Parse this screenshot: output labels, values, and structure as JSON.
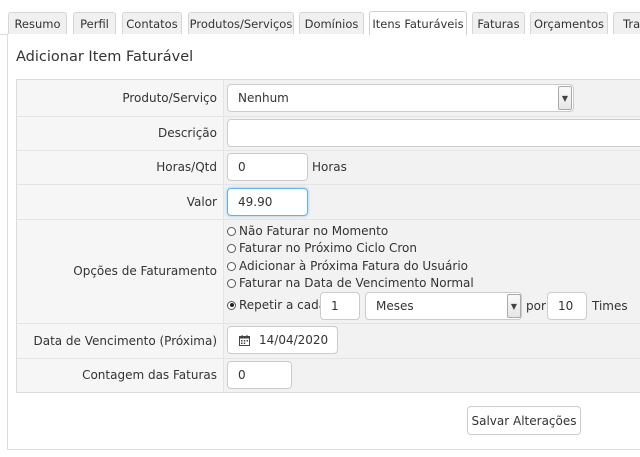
{
  "tabs": [
    {
      "label": "Resumo",
      "active": false
    },
    {
      "label": "Perfil",
      "active": false
    },
    {
      "label": "Contatos",
      "active": false
    },
    {
      "label": "Produtos/Serviços",
      "active": false
    },
    {
      "label": "Domínios",
      "active": false
    },
    {
      "label": "Itens Faturáveis",
      "active": true
    },
    {
      "label": "Faturas",
      "active": false
    },
    {
      "label": "Orçamentos",
      "active": false
    },
    {
      "label": "Tra",
      "active": false
    }
  ],
  "page": {
    "title": "Adicionar Item Faturável"
  },
  "form": {
    "produto": {
      "label": "Produto/Serviço",
      "value": "Nenhum",
      "icon": "chevron-down-icon"
    },
    "descricao": {
      "label": "Descrição",
      "value": ""
    },
    "horas": {
      "label": "Horas/Qtd",
      "value": "0",
      "unit": "Horas"
    },
    "valor": {
      "label": "Valor",
      "value": "49.90"
    },
    "opcoes": {
      "label": "Opções de Faturamento",
      "options": [
        "Não Faturar no Momento",
        "Faturar no Próximo Ciclo Cron",
        "Adicionar à Próxima Fatura do Usuário",
        "Faturar na Data de Vencimento Normal"
      ],
      "repeat": {
        "label": "Repetir a cada",
        "count": "1",
        "period": "Meses",
        "por_label": "por",
        "times_value": "10",
        "times_label": "Times",
        "checked": true
      }
    },
    "vencimento": {
      "label": "Data de Vencimento (Próxima)",
      "value": "14/04/2020",
      "icon": "calendar-icon"
    },
    "contagem": {
      "label": "Contagem das Faturas",
      "value": "0"
    }
  },
  "actions": {
    "save_label": "Salvar Alterações"
  }
}
